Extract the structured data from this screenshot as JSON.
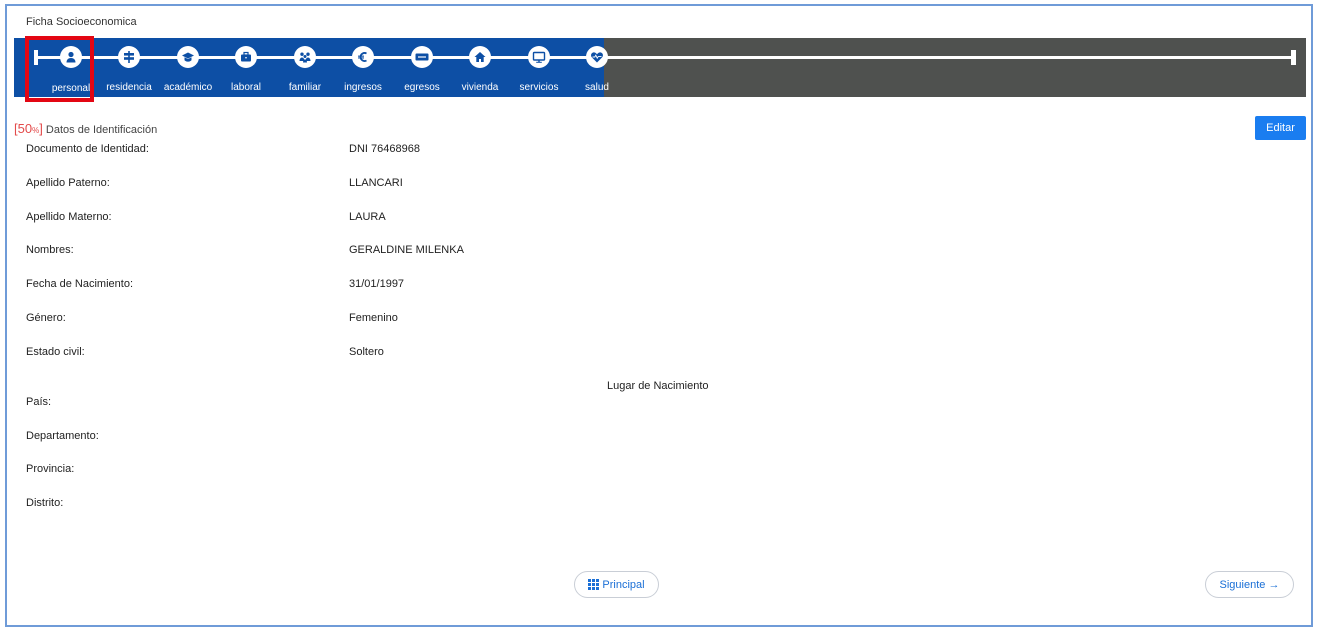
{
  "page": {
    "title": "Ficha Socioeconomica"
  },
  "stepper": {
    "steps": [
      {
        "label": "personal",
        "icon": "user-icon"
      },
      {
        "label": "residencia",
        "icon": "signpost-icon"
      },
      {
        "label": "académico",
        "icon": "graduation-cap-icon"
      },
      {
        "label": "laboral",
        "icon": "briefcase-icon"
      },
      {
        "label": "familiar",
        "icon": "family-icon"
      },
      {
        "label": "ingresos",
        "icon": "euro-icon"
      },
      {
        "label": "egresos",
        "icon": "visa-card-icon"
      },
      {
        "label": "vivienda",
        "icon": "home-icon"
      },
      {
        "label": "servicios",
        "icon": "monitor-icon"
      },
      {
        "label": "salud",
        "icon": "heart-pulse-icon"
      }
    ],
    "active": "personal",
    "colors": {
      "filled": "#0d4fa5",
      "empty": "#4f514f",
      "highlight": "#e30613"
    }
  },
  "section": {
    "bracket_open": "[",
    "percent": "50",
    "percent_sign": "%",
    "bracket_close": "]",
    "title": "Datos de Identificación",
    "edit_label": "Editar"
  },
  "fields": [
    {
      "label": "Documento de Identidad:",
      "value": "DNI 76468968"
    },
    {
      "label": "Apellido Paterno:",
      "value": "LLANCARI"
    },
    {
      "label": "Apellido Materno:",
      "value": "LAURA"
    },
    {
      "label": "Nombres:",
      "value": "GERALDINE MILENKA"
    },
    {
      "label": "Fecha de Nacimiento:",
      "value": "31/01/1997"
    },
    {
      "label": "Género:",
      "value": "Femenino"
    },
    {
      "label": "Estado civil:",
      "value": "Soltero"
    }
  ],
  "birthplace": {
    "title": "Lugar de Nacimiento",
    "fields": [
      {
        "label": "País:"
      },
      {
        "label": "Departamento:"
      },
      {
        "label": "Provincia:"
      },
      {
        "label": "Distrito:"
      }
    ]
  },
  "footer": {
    "main_label": "Principal",
    "next_label": "Siguiente →"
  }
}
